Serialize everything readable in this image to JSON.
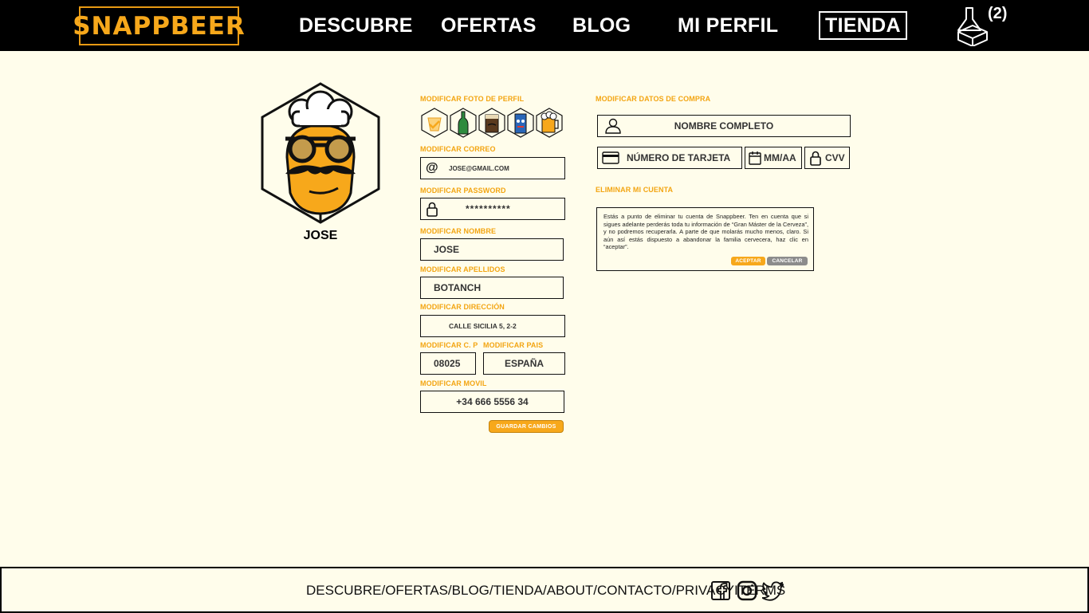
{
  "header": {
    "logo": "SNAPPBEER",
    "nav": [
      "DESCUBRE",
      "OFERTAS",
      "BLOG",
      "MI PERFIL",
      "TIENDA"
    ],
    "cart_count": "(2)"
  },
  "profile": {
    "name": "JOSE"
  },
  "form": {
    "photo_label": "MODIFICAR FOTO DE PERFIL",
    "email_label": "MODIFICAR CORREO",
    "email_value": "JOSE@GMAIL.COM",
    "password_label": "MODIFICAR PASSWORD",
    "password_value": "**********",
    "name_label": "MODIFICAR NOMBRE",
    "name_value": "JOSE",
    "surname_label": "MODIFICAR APELLIDOS",
    "surname_value": "BOTANCH",
    "address_label": "MODIFICAR DIRECCIÓN",
    "address_value": "CALLE SICILIA 5, 2-2",
    "cp_label": "MODIFICAR C. P",
    "cp_value": "08025",
    "country_label": "MODIFICAR PAIS",
    "country_value": "ESPAÑA",
    "mobile_label": "MODIFICAR MOVIL",
    "mobile_value": "+34 666 5556 34",
    "save_button": "GUARDAR CAMBIOS"
  },
  "purchase": {
    "label": "MODIFICAR DATOS DE COMPRA",
    "fullname_placeholder": "NOMBRE COMPLETO",
    "card_placeholder": "NÚMERO DE TARJETA",
    "expiry_placeholder": "MM/AA",
    "cvv_placeholder": "CVV"
  },
  "delete_account": {
    "label": "ELIMINAR MI CUENTA",
    "message": "Estás a punto de eliminar tu cuenta de Snappbeer. Ten en cuenta que si sigues adelante perderás toda tu información de “Gran Máster de la Cerveza”, y no podremos recuperarla. A parte de que molarás mucho menos, claro. Si aún así estás dispuesto a abandonar la familia cervecera, haz clic en “aceptar”.",
    "accept": "ACEPTAR",
    "cancel": "CANCELAR"
  },
  "footer": {
    "links": [
      "DESCUBRE",
      " / ",
      "OFERTAS",
      " / ",
      "BLOG",
      " / ",
      "TIENDA",
      " / ",
      "ABOUT",
      " / ",
      "CONTACTO",
      " / ",
      "PRIVACY",
      " I ",
      "TERMS"
    ]
  },
  "colors": {
    "accent": "#f7a81b",
    "background": "#fffdeb",
    "header": "#000000",
    "cancel": "#8c8c8c"
  }
}
